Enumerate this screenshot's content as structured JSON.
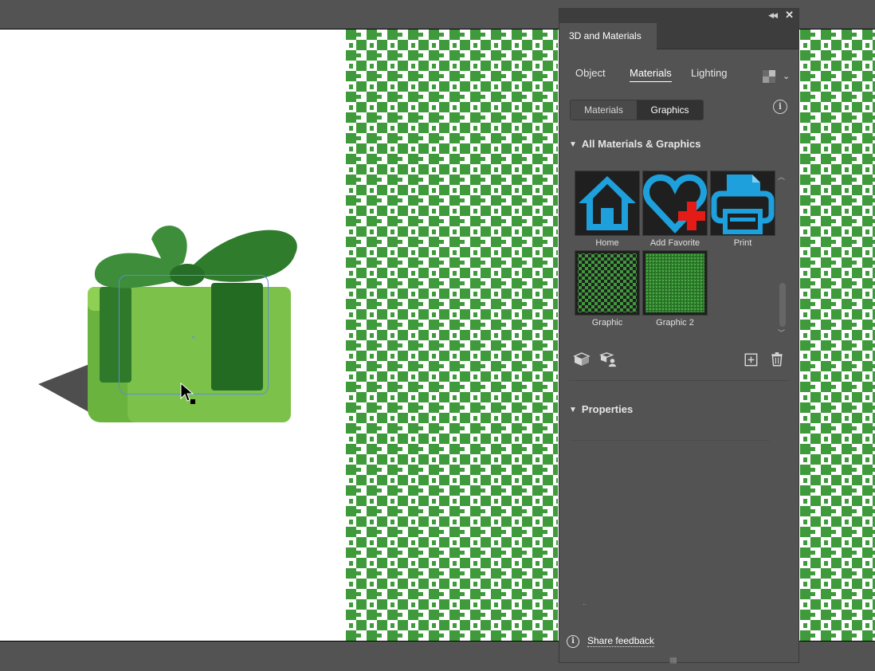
{
  "panel": {
    "title": "3D and Materials",
    "tabs": [
      {
        "label": "Object",
        "active": false
      },
      {
        "label": "Materials",
        "active": true
      },
      {
        "label": "Lighting",
        "active": false
      }
    ],
    "segment": [
      {
        "label": "Materials",
        "active": false
      },
      {
        "label": "Graphics",
        "active": true
      }
    ],
    "sections": {
      "all": "All Materials & Graphics",
      "properties": "Properties"
    },
    "graphics": [
      {
        "label": "Home",
        "icon": "home-icon"
      },
      {
        "label": "Add Favorite",
        "icon": "heart-plus-icon"
      },
      {
        "label": "Print",
        "icon": "printer-icon"
      },
      {
        "label": "Graphic",
        "icon": "green-pattern-graphic"
      },
      {
        "label": "Graphic 2",
        "icon": "green-texture-graphic"
      }
    ],
    "feedback": "Share feedback",
    "colors": {
      "icon_blue": "#1ea0dc",
      "plus_red": "#e41b17",
      "pattern_green": "#3e9a3a"
    }
  }
}
